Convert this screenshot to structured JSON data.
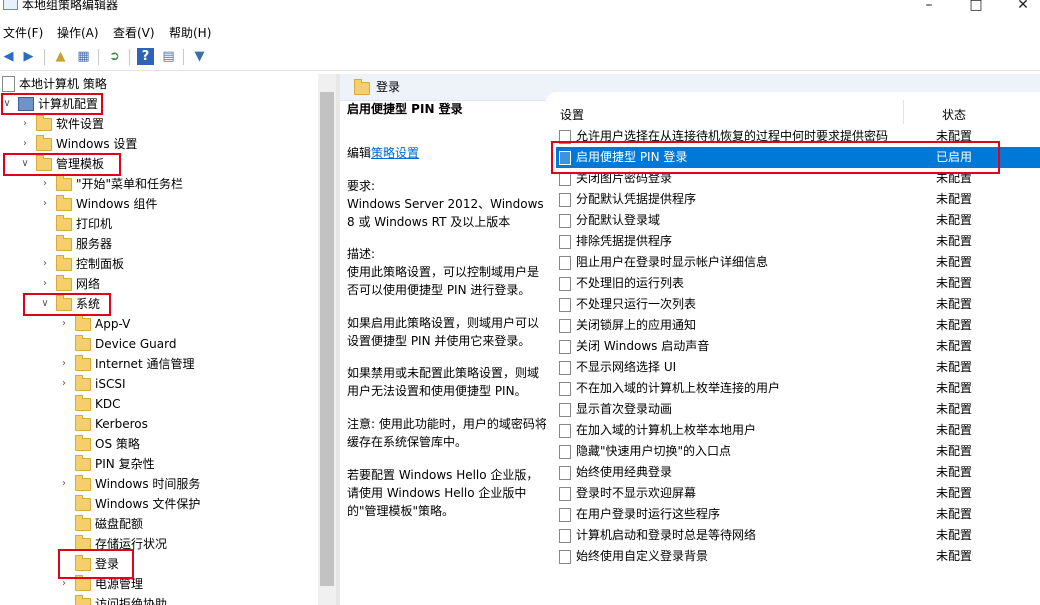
{
  "window": {
    "title": "本地组策略编辑器"
  },
  "menu": [
    "文件(F)",
    "操作(A)",
    "查看(V)",
    "帮助(H)"
  ],
  "toolbar_icons": [
    "back-icon",
    "forward-icon",
    "up-folder-icon",
    "show-hide-tree-icon",
    "export-list-icon",
    "help-icon",
    "properties-icon",
    "filter-icon"
  ],
  "tree": [
    {
      "label": "本地计算机 策略",
      "level": 0,
      "expander": "",
      "icon": "doc"
    },
    {
      "label": "计算机配置",
      "level": 1,
      "expander": "v",
      "icon": "pc"
    },
    {
      "label": "软件设置",
      "level": 2,
      "expander": ">",
      "icon": "folder"
    },
    {
      "label": "Windows 设置",
      "level": 2,
      "expander": ">",
      "icon": "folder"
    },
    {
      "label": "管理模板",
      "level": 2,
      "expander": "v",
      "icon": "folder"
    },
    {
      "label": "\"开始\"菜单和任务栏",
      "level": 3,
      "expander": ">",
      "icon": "folder"
    },
    {
      "label": "Windows 组件",
      "level": 3,
      "expander": ">",
      "icon": "folder"
    },
    {
      "label": "打印机",
      "level": 3,
      "expander": "",
      "icon": "folder"
    },
    {
      "label": "服务器",
      "level": 3,
      "expander": "",
      "icon": "folder"
    },
    {
      "label": "控制面板",
      "level": 3,
      "expander": ">",
      "icon": "folder"
    },
    {
      "label": "网络",
      "level": 3,
      "expander": ">",
      "icon": "folder"
    },
    {
      "label": "系统",
      "level": 3,
      "expander": "v",
      "icon": "folder"
    },
    {
      "label": "App-V",
      "level": 4,
      "expander": ">",
      "icon": "folder"
    },
    {
      "label": "Device Guard",
      "level": 4,
      "expander": "",
      "icon": "folder"
    },
    {
      "label": "Internet 通信管理",
      "level": 4,
      "expander": ">",
      "icon": "folder"
    },
    {
      "label": "iSCSI",
      "level": 4,
      "expander": ">",
      "icon": "folder"
    },
    {
      "label": "KDC",
      "level": 4,
      "expander": "",
      "icon": "folder"
    },
    {
      "label": "Kerberos",
      "level": 4,
      "expander": "",
      "icon": "folder"
    },
    {
      "label": "OS 策略",
      "level": 4,
      "expander": "",
      "icon": "folder"
    },
    {
      "label": "PIN 复杂性",
      "level": 4,
      "expander": "",
      "icon": "folder"
    },
    {
      "label": "Windows 时间服务",
      "level": 4,
      "expander": ">",
      "icon": "folder"
    },
    {
      "label": "Windows 文件保护",
      "level": 4,
      "expander": "",
      "icon": "folder"
    },
    {
      "label": "磁盘配额",
      "level": 4,
      "expander": "",
      "icon": "folder"
    },
    {
      "label": "存储运行状况",
      "level": 4,
      "expander": "",
      "icon": "folder"
    },
    {
      "label": "登录",
      "level": 4,
      "expander": "",
      "icon": "folder"
    },
    {
      "label": "电源管理",
      "level": 4,
      "expander": ">",
      "icon": "folder"
    },
    {
      "label": "访问拒绝协助",
      "level": 4,
      "expander": "",
      "icon": "folder"
    }
  ],
  "right_header": "登录",
  "detail": {
    "title": "启用便捷型 PIN 登录",
    "edit_prefix": "编辑",
    "edit_link": "策略设置",
    "req_label": "要求:",
    "req_text": "Windows Server 2012、Windows 8 或 Windows RT 及以上版本",
    "desc_label": "描述:",
    "desc_text": "使用此策略设置，可以控制域用户是否可以使用便捷型 PIN 进行登录。",
    "enabled_text": "如果启用此策略设置，则域用户可以设置便捷型 PIN 并使用它来登录。",
    "disabled_text": "如果禁用或未配置此策略设置，则域用户无法设置和使用便捷型 PIN。",
    "note_text": "注意: 使用此功能时，用户的域密码将缓存在系统保管库中。",
    "hello_text": "若要配置 Windows Hello 企业版，请使用 Windows Hello 企业版中的\"管理模板\"策略。"
  },
  "columns": {
    "setting": "设置",
    "state": "状态"
  },
  "settings": [
    {
      "name": "允许用户选择在从连接待机恢复的过程中何时要求提供密码",
      "state": "未配置"
    },
    {
      "name": "启用便捷型 PIN 登录",
      "state": "已启用",
      "selected": true
    },
    {
      "name": "关闭图片密码登录",
      "state": "未配置"
    },
    {
      "name": "分配默认凭据提供程序",
      "state": "未配置"
    },
    {
      "name": "分配默认登录域",
      "state": "未配置"
    },
    {
      "name": "排除凭据提供程序",
      "state": "未配置"
    },
    {
      "name": "阻止用户在登录时显示帐户详细信息",
      "state": "未配置"
    },
    {
      "name": "不处理旧的运行列表",
      "state": "未配置"
    },
    {
      "name": "不处理只运行一次列表",
      "state": "未配置"
    },
    {
      "name": "关闭锁屏上的应用通知",
      "state": "未配置"
    },
    {
      "name": "关闭 Windows 启动声音",
      "state": "未配置"
    },
    {
      "name": "不显示网络选择 UI",
      "state": "未配置"
    },
    {
      "name": "不在加入域的计算机上枚举连接的用户",
      "state": "未配置"
    },
    {
      "name": "显示首次登录动画",
      "state": "未配置"
    },
    {
      "name": "在加入域的计算机上枚举本地用户",
      "state": "未配置"
    },
    {
      "name": "隐藏\"快速用户切换\"的入口点",
      "state": "未配置"
    },
    {
      "name": "始终使用经典登录",
      "state": "未配置"
    },
    {
      "name": "登录时不显示欢迎屏幕",
      "state": "未配置"
    },
    {
      "name": "在用户登录时运行这些程序",
      "state": "未配置"
    },
    {
      "name": "计算机启动和登录时总是等待网络",
      "state": "未配置"
    },
    {
      "name": "始终使用自定义登录背景",
      "state": "未配置"
    }
  ],
  "colors": {
    "selection": "#0078d7",
    "highlight_box": "#e0001b",
    "link": "#0066cc"
  }
}
